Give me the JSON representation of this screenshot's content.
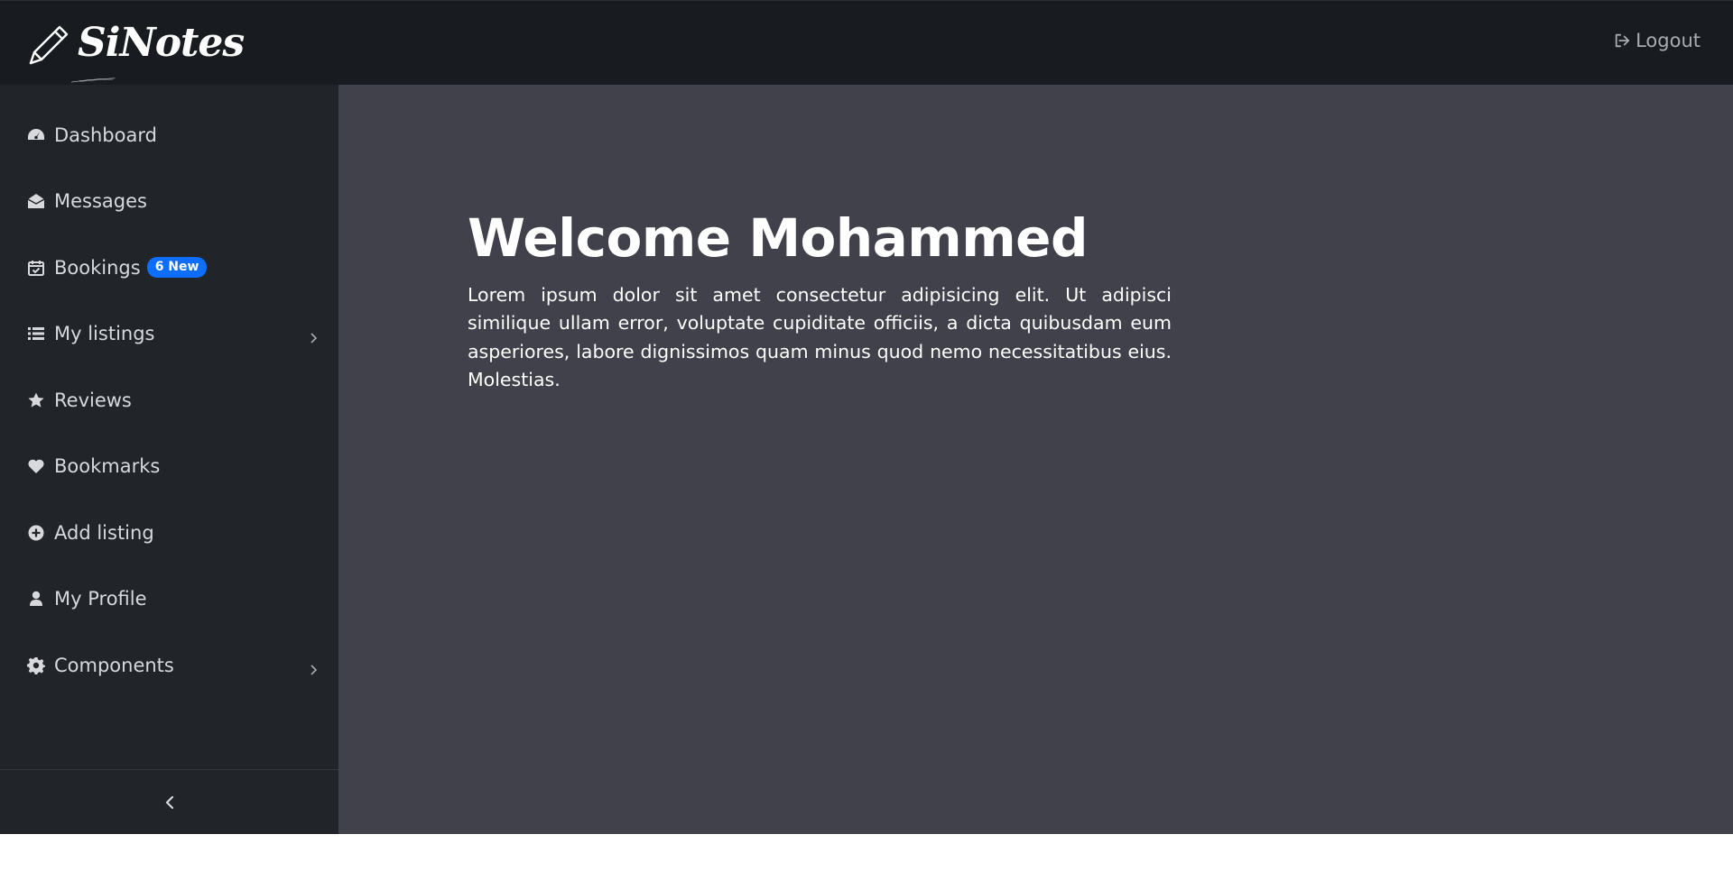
{
  "header": {
    "brand": "SiNotes",
    "logout_label": "Logout"
  },
  "sidebar": {
    "items": [
      {
        "label": "Dashboard",
        "icon": "dashboard-icon"
      },
      {
        "label": "Messages",
        "icon": "envelope-open-icon"
      },
      {
        "label": "Bookings",
        "icon": "calendar-check-icon",
        "badge": "6 New"
      },
      {
        "label": "My listings",
        "icon": "list-icon",
        "submenu": true
      },
      {
        "label": "Reviews",
        "icon": "star-icon"
      },
      {
        "label": "Bookmarks",
        "icon": "heart-icon"
      },
      {
        "label": "Add listing",
        "icon": "plus-circle-icon"
      },
      {
        "label": "My Profile",
        "icon": "user-icon"
      },
      {
        "label": "Components",
        "icon": "gear-icon",
        "submenu": true
      }
    ],
    "collapse_icon": "chevron-left-icon"
  },
  "main": {
    "title": "Welcome Mohammed",
    "body": "Lorem ipsum dolor sit amet consectetur adipisicing elit. Ut adipisci similique ullam error, voluptate cupiditate officiis, a dicta quibusdam eum asperiores, labore dignissimos quam minus quod nemo necessitatibus eius. Molestias."
  },
  "colors": {
    "topbar": "#181b1f",
    "sidebar": "#212429",
    "main": "#41414b",
    "badge": "#0d6efd"
  }
}
